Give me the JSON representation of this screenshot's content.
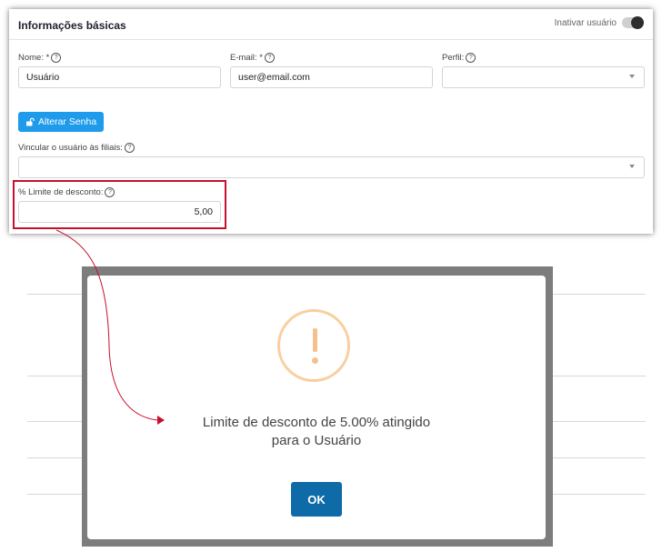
{
  "panel": {
    "title": "Informações básicas",
    "inactivate_label": "Inativar usuário"
  },
  "fields": {
    "name": {
      "label": "Nome: *",
      "value": "Usuário"
    },
    "email": {
      "label": "E-mail: *",
      "value": "user@email.com"
    },
    "profile": {
      "label": "Perfil:",
      "value": ""
    },
    "branches": {
      "label": "Vincular o usuário às filiais:",
      "value": ""
    },
    "discount": {
      "label": "% Limite de desconto:",
      "value": "5,00"
    }
  },
  "buttons": {
    "change_password": "Alterar Senha"
  },
  "modal": {
    "message_line1": "Limite de desconto de 5.00% atingido",
    "message_line2": "para o Usuário",
    "ok_label": "OK"
  },
  "colors": {
    "primary_button": "#1e9bea",
    "ok_button": "#0f6aa8",
    "highlight": "#c8102e",
    "warning": "#f6c08d"
  }
}
